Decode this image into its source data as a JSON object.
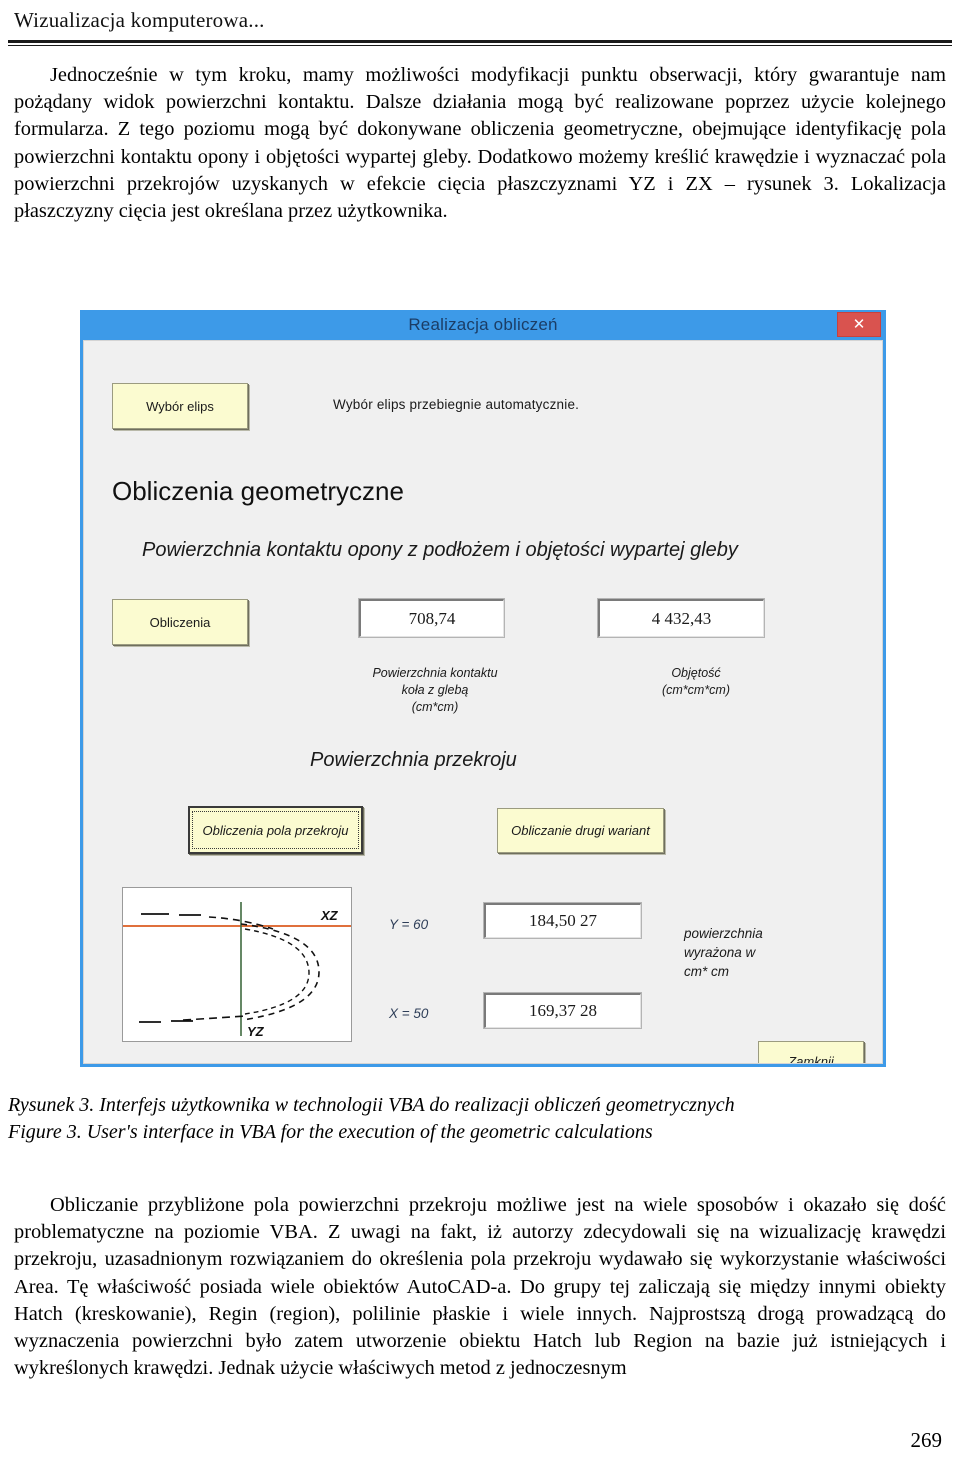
{
  "running_head": "Wizualizacja komputerowa...",
  "paragraph_top": "Jednocześnie w tym kroku, mamy możliwości modyfikacji punktu obserwacji, który gwarantuje nam pożądany widok powierzchni kontaktu. Dalsze działania mogą być realizowane poprzez użycie kolejnego formularza. Z tego poziomu mogą być dokonywane obliczenia geometryczne, obejmujące identyfikację pola powierzchni kontaktu opony i objętości wypartej gleby. Dodatkowo możemy kreślić krawędzie i wyznaczać pola powierzchni przekrojów uzyskanych w efekcie cięcia płaszczyznami YZ i ZX – rysunek 3. Lokalizacja płaszczyzny cięcia jest określana przez użytkownika.",
  "dialog": {
    "title": "Realizacja obliczeń",
    "close_glyph": "✕",
    "select_ellipse_button": "Wybór elips",
    "auto_note": "Wybór elips przebiegnie automatycznie.",
    "heading": "Obliczenia geometryczne",
    "subtitle_contact": "Powierzchnia kontaktu opony z podłożem i objętości wypartej gleby",
    "calc_button": "Obliczenia",
    "contact_area_value": "708,74",
    "contact_area_caption": "Powierzchnia kontaktu\nkoła z glebą\n(cm*cm)",
    "contact_area_caption_line1": "Powierzchnia kontaktu",
    "contact_area_caption_line2": "koła z glebą",
    "contact_area_caption_line3": "(cm*cm)",
    "volume_value": "4 432,43",
    "volume_caption_line1": "Objętość",
    "volume_caption_line2": "(cm*cm*cm)",
    "section_title": "Powierzchnia przekroju",
    "section_calc_button": "Obliczenia pola przekroju",
    "second_variant_button": "Obliczanie drugi wariant",
    "diagram": {
      "label_xz": "XZ",
      "label_yz": "YZ",
      "horizontal_line_color": "#e0703c",
      "vertical_line_color": "#3f6b3f"
    },
    "y_axis_label": "Y = 60",
    "y_axis_value": "184,50  27",
    "x_axis_label": "X = 50",
    "x_axis_value": "169,37  28",
    "unit_note_line1": "powierzchnia",
    "unit_note_line2": "wyrażona w",
    "unit_note_line3": "cm* cm",
    "close_button": "Zamknij",
    "titlebar_color": "#3d9ae8",
    "close_button_color": "#d9534f",
    "button_color": "#fbfbd0"
  },
  "caption_pl": "Rysunek 3. Interfejs użytkownika w technologii VBA do realizacji obliczeń geometrycznych",
  "caption_en": "Figure 3. User's interface in VBA for the execution of the geometric calculations",
  "paragraph_bottom": "Obliczanie przybliżone pola powierzchni przekroju możliwe jest na wiele sposobów i okazało się dość problematyczne na poziomie VBA. Z uwagi na fakt, iż autorzy zdecydowali się na wizualizację krawędzi przekroju, uzasadnionym rozwiązaniem do określenia pola przekroju wydawało się wykorzystanie właściwości Area. Tę właściwość posiada wiele obiektów AutoCAD-a. Do grupy tej zaliczają się między innymi obiekty Hatch (kreskowanie), Regin (region), polilinie płaskie i wiele innych. Najprostszą drogą prowadzącą do wyznaczenia powierzchni było zatem utworzenie obiektu Hatch lub Region na bazie już istniejących i wykreślonych krawędzi. Jednak użycie właściwych metod z jednoczesnym",
  "page_number": "269"
}
